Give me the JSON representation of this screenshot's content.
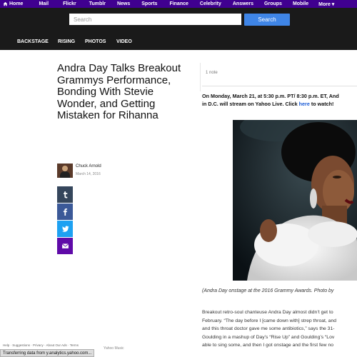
{
  "topnav": {
    "items": [
      "Home",
      "Mail",
      "Flickr",
      "Tumblr",
      "News",
      "Sports",
      "Finance",
      "Celebrity",
      "Answers",
      "Groups",
      "Mobile",
      "More ▾"
    ]
  },
  "search": {
    "placeholder": "Search",
    "button_label": "Search"
  },
  "sections": [
    "BACKSTAGE",
    "RISING",
    "PHOTOS",
    "VIDEO"
  ],
  "article": {
    "title": "Andra Day Talks Breakout Grammys Performance, Bonding With Stevie Wonder, and Getting Mistaken for Rihanna",
    "author": "Chuck Arnold",
    "date": "March 14, 2016",
    "notes": "1 note",
    "lead_line1": "On Monday, March 21, at 5:30 p.m. PT/ 8:30 p.m. ET, And",
    "lead_line2_a": "in D.C. will stream on Yahoo Live. Click ",
    "lead_link": "here",
    "lead_line2_b": " to watch!",
    "caption": "(Andra Day onstage at the 2016 Grammy Awards. Photo by",
    "body_lines": [
      "Breakout retro-soul chanteuse Andra Day almost didn’t get to",
      "February. “The day before I [came down with] strep throat, and",
      "and this throat doctor gave me some antibiotics,” says the 31-",
      "Goulding in a mashup of Day’s “Rise Up” and Goulding’s “Lov",
      "able to sing some, and then I got onstage and the first few no"
    ]
  },
  "share": [
    {
      "name": "tumblr-icon",
      "color": "#35465c",
      "glyph": "t"
    },
    {
      "name": "facebook-icon",
      "color": "#3b5998",
      "glyph": "f"
    },
    {
      "name": "twitter-icon",
      "color": "#1da1f2",
      "glyph": "bird"
    },
    {
      "name": "mail-icon",
      "color": "#5f0aa8",
      "glyph": "mail"
    }
  ],
  "footer": {
    "links": "Help · Suggestions · Privacy · About Our Ads · Terms",
    "yahoo_music": "Yahoo Music",
    "status": "Transferring data from y.analytics.yahoo.com..."
  },
  "colors": {
    "brand_purple": "#400090",
    "search_blue": "#3f85e6",
    "dark_band": "#1a1a1a"
  }
}
